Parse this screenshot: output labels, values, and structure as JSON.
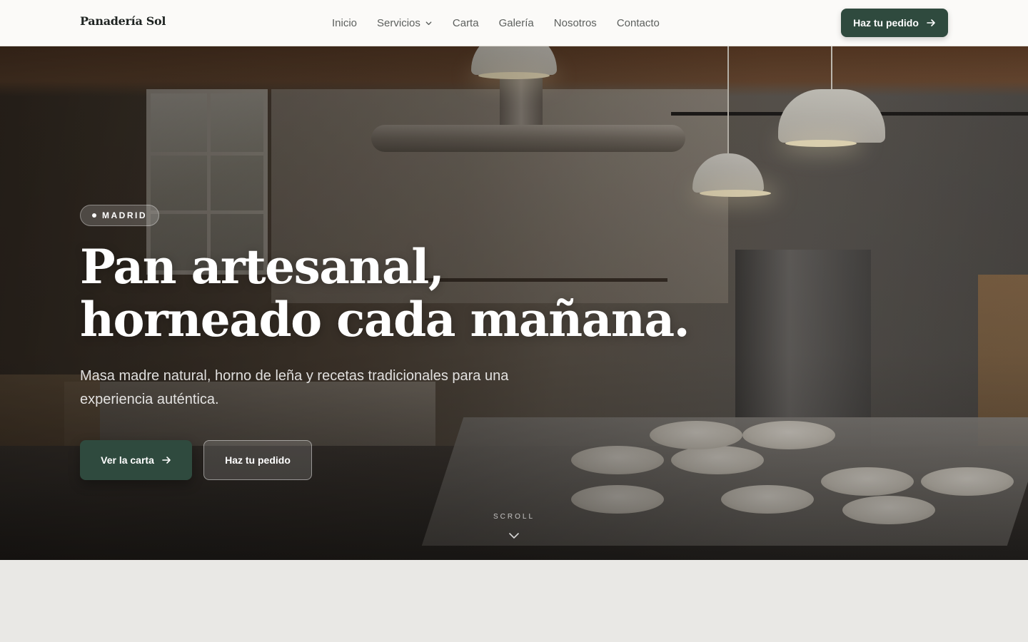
{
  "nav": {
    "brand": "Panadería Sol",
    "items": [
      {
        "label": "Inicio"
      },
      {
        "label": "Servicios"
      },
      {
        "label": "Carta"
      },
      {
        "label": "Galería"
      },
      {
        "label": "Nosotros"
      },
      {
        "label": "Contacto"
      }
    ],
    "cta_label": "Haz tu pedido"
  },
  "hero": {
    "badge": "MADRID",
    "headline_line1": "Pan artesanal,",
    "headline_line2": "horneado cada mañana.",
    "subtitle": "Masa madre natural, horno de leña y recetas tradicionales para una experiencia auténtica.",
    "primary_button": "Ver la carta",
    "secondary_button": "Haz tu pedido",
    "scroll_label": "SCROLL"
  },
  "colors": {
    "accent": "#2f4a3e",
    "nav_bg": "#fbfaf8",
    "page_bg": "#e9e8e5"
  },
  "icons": {
    "services_dropdown": "chevron-down-icon",
    "cta_arrow": "arrow-right-icon",
    "scroll": "chevron-down-icon"
  }
}
